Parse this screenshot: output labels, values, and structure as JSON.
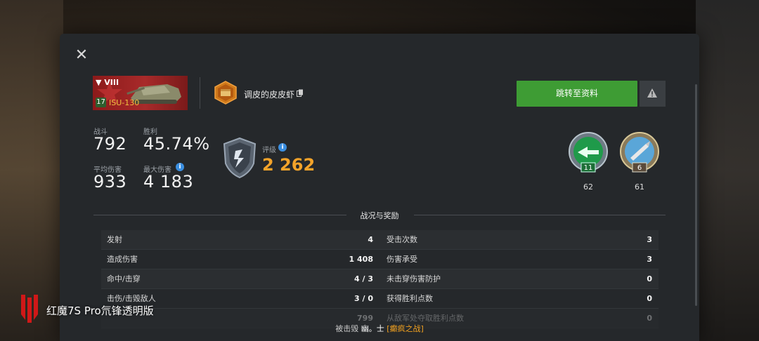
{
  "window": {
    "close_icon": "close-icon"
  },
  "tank": {
    "tier": "▼ VIII",
    "level": "17",
    "name": "ISU-130",
    "card_color": "#a82a2a"
  },
  "player": {
    "name": "调皮的皮皮虾",
    "badge_icon": "clan-shell-icon",
    "copy_icon": "copy-icon"
  },
  "actions": {
    "goto_profile": "跳转至资料",
    "report_icon": "warning-icon"
  },
  "stats": {
    "battles_label": "战斗",
    "battles_value": "792",
    "wins_label": "胜利",
    "wins_value": "45.74%",
    "avg_damage_label": "平均伤害",
    "avg_damage_value": "933",
    "max_damage_label": "最大伤害",
    "max_damage_value": "4 183",
    "rating_label": "评级",
    "rating_value": "2 262"
  },
  "medals": [
    {
      "icon": "medal-green-arrows-icon",
      "badge": "11",
      "count": "62"
    },
    {
      "icon": "medal-blue-shell-icon",
      "badge": "6",
      "count": "61"
    }
  ],
  "section": {
    "title": "战况与奖励"
  },
  "battle_rows": [
    {
      "left_label": "发射",
      "left_value": "4",
      "right_label": "受击次数",
      "right_value": "3"
    },
    {
      "left_label": "造成伤害",
      "left_value": "1 408",
      "right_label": "伤害承受",
      "right_value": "3"
    },
    {
      "left_label": "命中/击穿",
      "left_value": "4 / 3",
      "right_label": "未击穿伤害防护",
      "right_value": "0"
    },
    {
      "left_label": "击伤/击毁敌人",
      "left_value": "3 / 0",
      "right_label": "获得胜利点数",
      "right_value": "0"
    },
    {
      "left_label": "",
      "left_value": "799",
      "right_label": "从敌军处夺取胜利点数",
      "right_value": "0"
    }
  ],
  "footer": {
    "prefix": "被击毁",
    "killer": "幽。士",
    "clan": "[癫疯之战]"
  },
  "watermark": {
    "text": "红魔7S Pro氘锋透明版"
  },
  "colors": {
    "accent_green": "#3e9c34",
    "rating_orange": "#f3a32a",
    "panel_bg": "#25282b"
  }
}
